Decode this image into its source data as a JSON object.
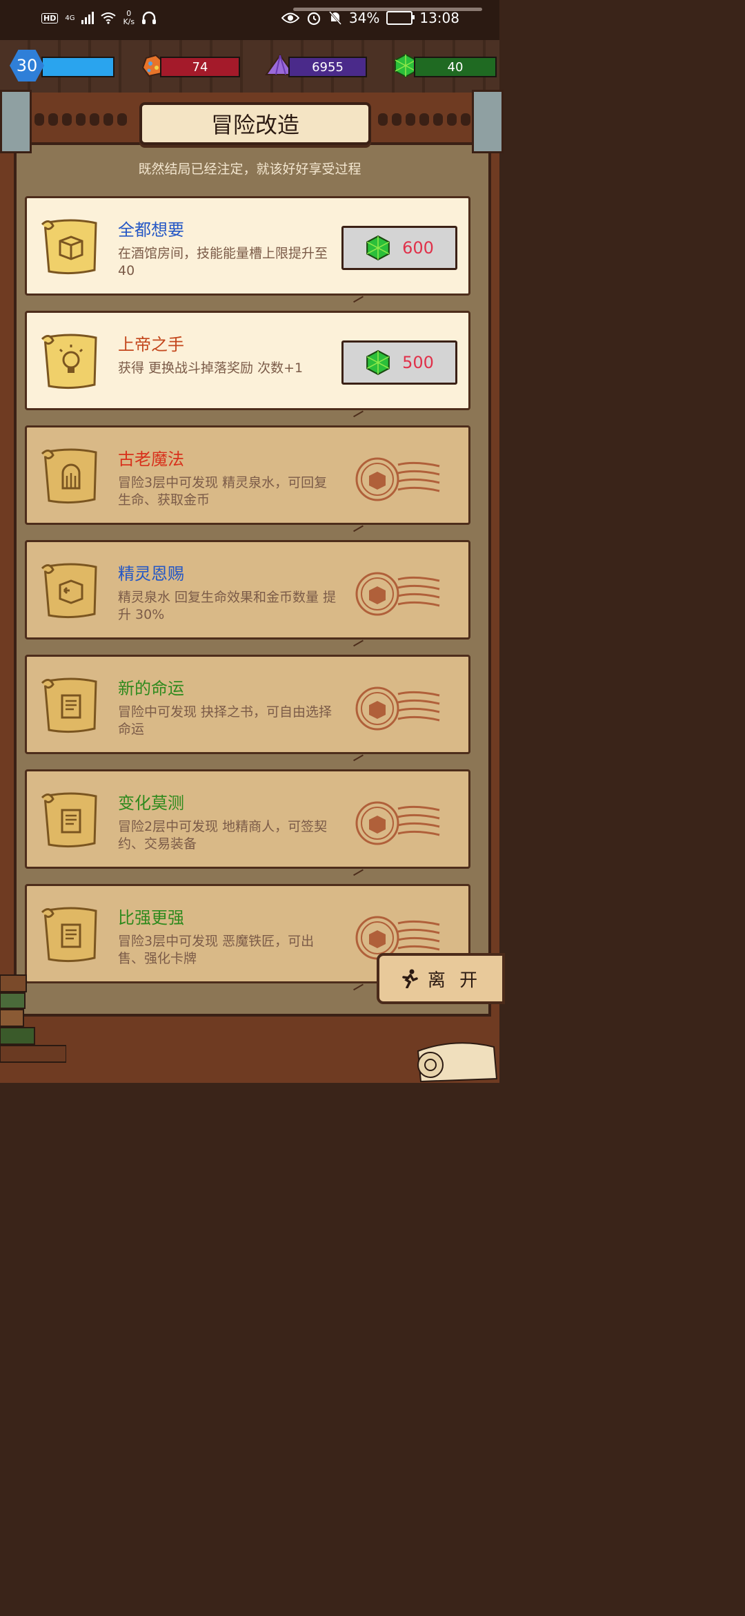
{
  "status_bar": {
    "hd": "HD",
    "net_type": "4G",
    "speed_value": "0",
    "speed_unit": "K/s",
    "battery": "34%",
    "time": "13:08"
  },
  "resources": {
    "level": "30",
    "ore": "74",
    "crystal": "6955",
    "gem": "40"
  },
  "header": {
    "title": "冒险改造",
    "subtitle": "既然结局已经注定，就该好好享受过程"
  },
  "upgrades": [
    {
      "title": "全都想要",
      "title_color": "#2457c5",
      "desc": "在酒馆房间，技能能量槽上限提升至40",
      "price": "600",
      "state": "active"
    },
    {
      "title": "上帝之手",
      "title_color": "#c3461c",
      "desc": "获得 更换战斗掉落奖励 次数+1",
      "price": "500",
      "state": "active"
    },
    {
      "title": "古老魔法",
      "title_color": "#d8311c",
      "desc": "冒险3层中可发现 精灵泉水，可回复生命、获取金币",
      "state": "locked"
    },
    {
      "title": "精灵恩赐",
      "title_color": "#2457c5",
      "desc": "精灵泉水 回复生命效果和金币数量 提升 30%",
      "state": "locked"
    },
    {
      "title": "新的命运",
      "title_color": "#2f8a1e",
      "desc": "冒险中可发现 抉择之书，可自由选择命运",
      "state": "locked"
    },
    {
      "title": "变化莫测",
      "title_color": "#2f8a1e",
      "desc": "冒险2层中可发现 地精商人，可签契约、交易装备",
      "state": "locked"
    },
    {
      "title": "比强更强",
      "title_color": "#2f8a1e",
      "desc": "冒险3层中可发现 恶魔铁匠，可出售、强化卡牌",
      "state": "locked"
    }
  ],
  "exit_button": {
    "label": "离 开"
  },
  "colors": {
    "gem_green": "#2bbf3a",
    "price_red": "#e0314a",
    "level_blue": "#2f7fd8"
  }
}
